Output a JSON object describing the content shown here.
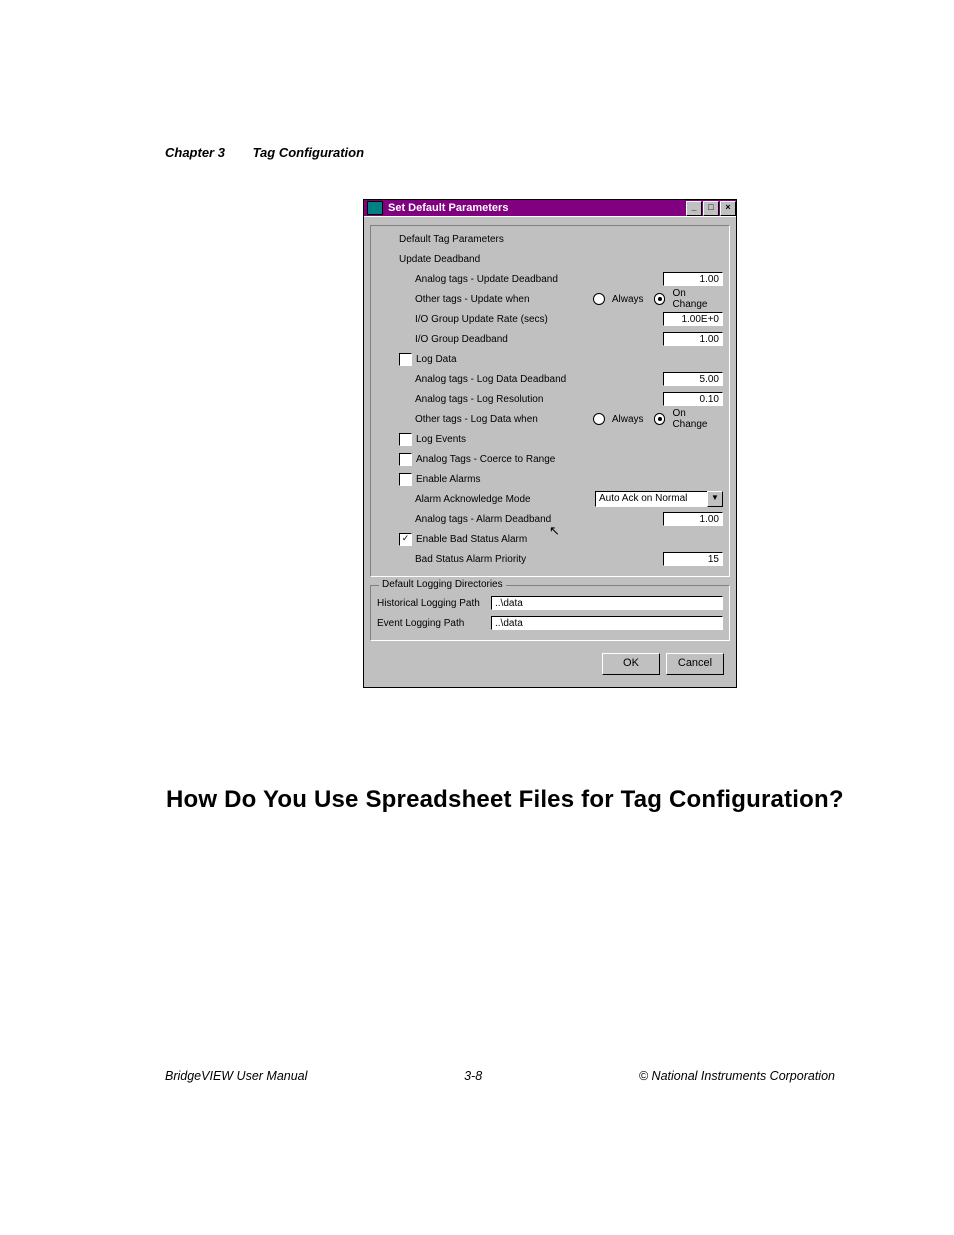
{
  "header": {
    "chapter": "Chapter 3",
    "title": "Tag Configuration"
  },
  "dialog": {
    "title": "Set Default Parameters",
    "win_buttons": {
      "min": "_",
      "max": "□",
      "close": "×"
    },
    "group_params": {
      "section_label": "Default Tag Parameters",
      "update_deadband_label": "Update Deadband",
      "analog_update_deadband": {
        "label": "Analog tags - Update Deadband",
        "value": "1.00"
      },
      "other_update_when": {
        "label": "Other tags - Update when",
        "opt_always": "Always",
        "opt_onchange": "On Change",
        "selected": "onchange"
      },
      "io_rate": {
        "label": "I/O Group Update Rate (secs)",
        "value": "1.00E+0"
      },
      "io_deadband": {
        "label": "I/O Group Deadband",
        "value": "1.00"
      },
      "log_data": {
        "label": "Log Data",
        "checked": false
      },
      "log_data_deadband": {
        "label": "Analog tags - Log Data Deadband",
        "value": "5.00"
      },
      "log_resolution": {
        "label": "Analog tags - Log Resolution",
        "value": "0.10"
      },
      "other_log_when": {
        "label": "Other tags - Log Data when",
        "opt_always": "Always",
        "opt_onchange": "On Change",
        "selected": "onchange"
      },
      "log_events": {
        "label": "Log Events",
        "checked": false
      },
      "coerce": {
        "label": "Analog Tags - Coerce to Range",
        "checked": false
      },
      "enable_alarms": {
        "label": "Enable Alarms",
        "checked": false
      },
      "ack_mode": {
        "label": "Alarm Acknowledge Mode",
        "value": "Auto Ack on Normal"
      },
      "alarm_deadband": {
        "label": "Analog tags - Alarm Deadband",
        "value": "1.00"
      },
      "bad_status": {
        "label": "Enable Bad Status Alarm",
        "checked": true
      },
      "bad_priority": {
        "label": "Bad Status Alarm Priority",
        "value": "15"
      }
    },
    "group_dirs": {
      "legend": "Default Logging Directories",
      "hist": {
        "label": "Historical Logging Path",
        "value": "..\\data"
      },
      "event": {
        "label": "Event Logging Path",
        "value": "..\\data"
      }
    },
    "buttons": {
      "ok": "OK",
      "cancel": "Cancel"
    }
  },
  "heading": "How Do You Use Spreadsheet Files for Tag Configuration?",
  "footer": {
    "left": "BridgeVIEW User Manual",
    "center": "3-8",
    "right": "© National Instruments Corporation"
  }
}
